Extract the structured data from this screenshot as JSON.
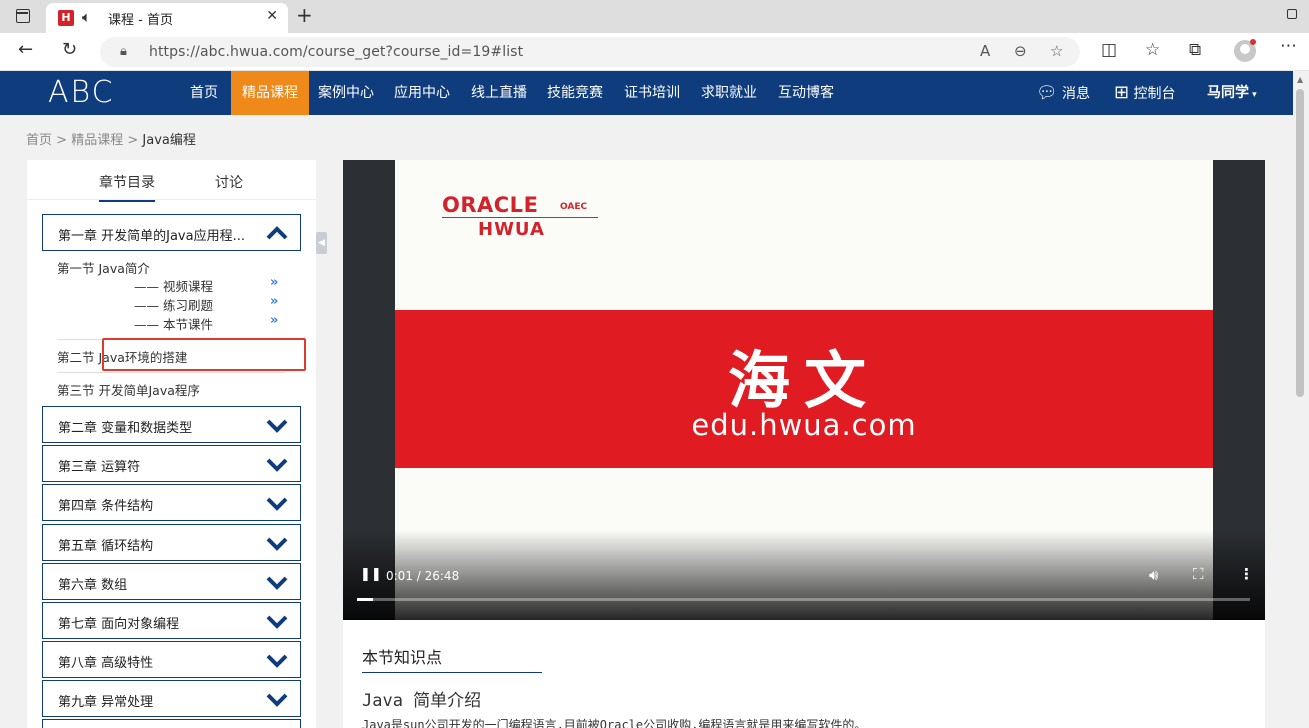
{
  "browser": {
    "tab_title": "课程 - 首页",
    "favicon_letter": "H",
    "url": "https://abc.hwua.com/course_get?course_id=19#list"
  },
  "site": {
    "logo": "ABC",
    "nav": [
      "首页",
      "精品课程",
      "案例中心",
      "应用中心",
      "线上直播",
      "技能竞赛",
      "证书培训",
      "求职就业",
      "互动博客"
    ],
    "active_nav": "精品课程",
    "messages": "消息",
    "console": "控制台",
    "user": "马同学",
    "accent_color": "#0f3c7c",
    "active_color": "#ef8a1a"
  },
  "breadcrumb": {
    "home": "首页",
    "sep1": ">",
    "level2": "精品课程",
    "sep2": ">",
    "current": "Java编程"
  },
  "sidebar": {
    "tabs": [
      "章节目录",
      "讨论"
    ],
    "chapter1": "第一章 开发简单的Java应用程...",
    "sections": [
      "第一节 Java简介",
      "第二节 Java环境的搭建",
      "第三节 开发简单Java程序"
    ],
    "sub_items": [
      "—— 视频课程",
      "—— 练习刷题",
      "—— 本节课件"
    ],
    "chapters": [
      "第二章 变量和数据类型",
      "第三章 运算符",
      "第四章 条件结构",
      "第五章 循环结构",
      "第六章 数组",
      "第七章 面向对象编程",
      "第八章 高级特性",
      "第九章 异常处理"
    ]
  },
  "video": {
    "logo_oracle": "ORACLE",
    "logo_oaec": "OAEC",
    "logo_hwua": "HWUA",
    "brand_cn": "海文",
    "brand_url": "edu.hwua.com",
    "time": "0:01 / 26:48",
    "progress": 0.0006
  },
  "content": {
    "knowledge_title": "本节知识点",
    "section_title": "Java 简单介绍",
    "paragraph": "Java是sun公司开发的一门编程语言,目前被Oracle公司收购,编程语言就是用来编写软件的。"
  }
}
